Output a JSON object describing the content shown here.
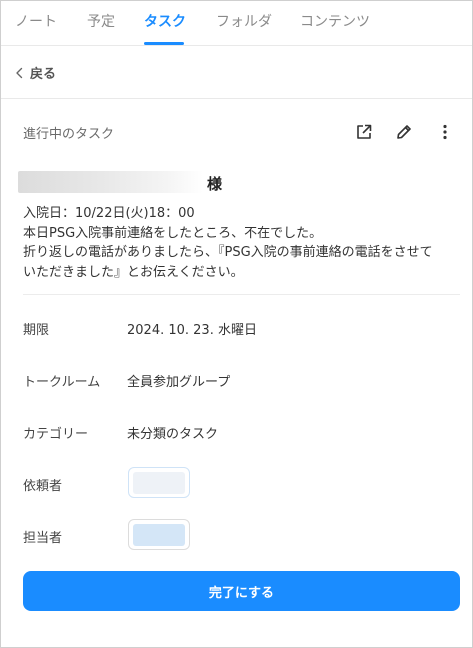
{
  "tabs": [
    {
      "label": "ノート"
    },
    {
      "label": "予定"
    },
    {
      "label": "タスク"
    },
    {
      "label": "フォルダ"
    },
    {
      "label": "コンテンツ"
    }
  ],
  "active_tab": "タスク",
  "back": {
    "label": "戻る"
  },
  "task": {
    "status": "進行中のタスク",
    "customer_suffix": "様",
    "description_lines": [
      "入院日：10/22日(火)18：00",
      "本日PSG入院事前連絡をしたところ、不在でした。",
      "折り返しの電話がありましたら、『PSG入院の事前連絡の電話をさせて",
      "いただきました』とお伝えください。"
    ]
  },
  "details": {
    "due_label": "期限",
    "due_value": "2024. 10. 23. 水曜日",
    "room_label": "トークルーム",
    "room_value": "全員参加グループ",
    "category_label": "カテゴリー",
    "category_value": "未分類のタスク",
    "requester_label": "依頼者",
    "assignee_label": "担当者"
  },
  "complete_button": "完了にする",
  "icons": {
    "back": "chevron-left-icon",
    "open": "external-link-icon",
    "edit": "pencil-icon",
    "more": "more-vertical-icon"
  },
  "colors": {
    "accent": "#1a8cff",
    "requester_avatar": "#eef2f7",
    "assignee_avatar": "#d4e6f7"
  }
}
